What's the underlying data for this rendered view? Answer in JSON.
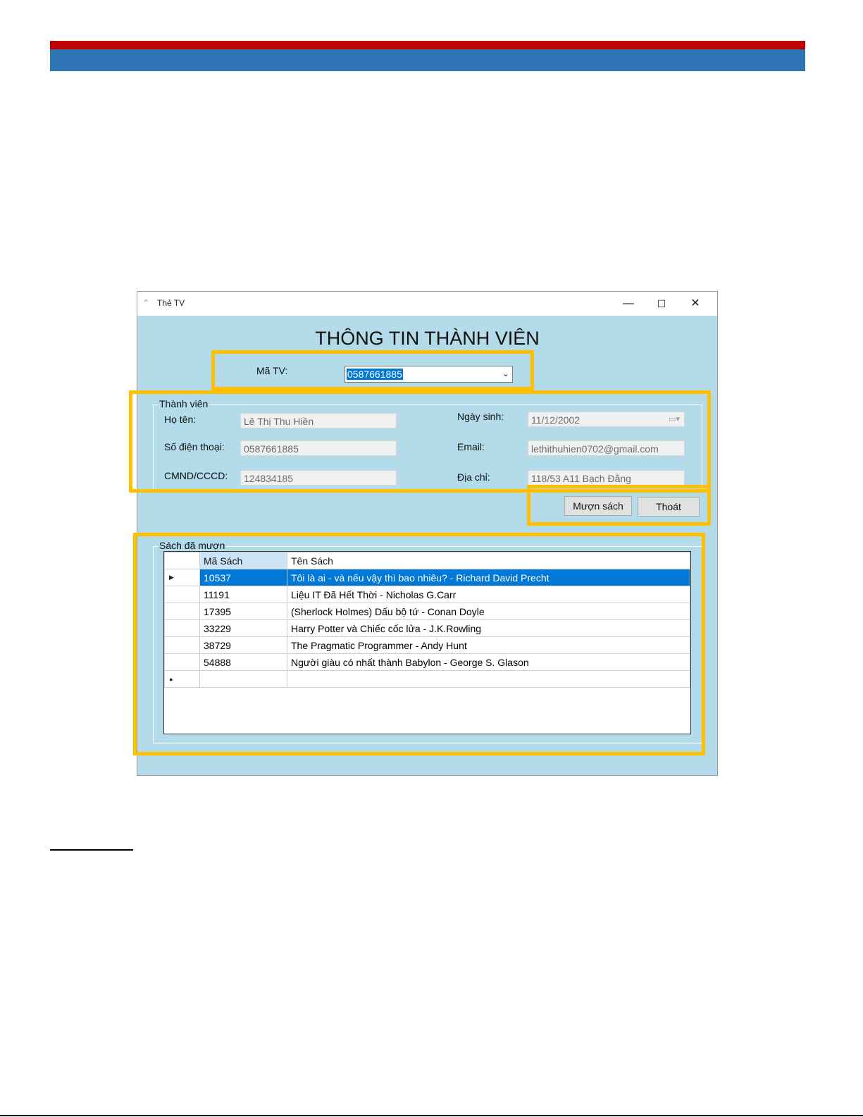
{
  "window": {
    "title": "Thẻ TV",
    "icon": "app-icon",
    "controls": {
      "minimize": "—",
      "maximize": "☐",
      "close": "✕"
    }
  },
  "form": {
    "heading": "THÔNG TIN THÀNH VIÊN",
    "member_id": {
      "label": "Mã TV:",
      "value": "0587661885"
    }
  },
  "member_group": {
    "title": "Thành viên",
    "name": {
      "label": "Họ tên:",
      "value": "Lê Thị Thu Hiền"
    },
    "phone": {
      "label": "Số điện thoại:",
      "value": "0587661885"
    },
    "id_card": {
      "label": "CMND/CCCD:",
      "value": "124834185"
    },
    "birthday": {
      "label": "Ngày sinh:",
      "value": "11/12/2002"
    },
    "email": {
      "label": "Email:",
      "value": "lethithuhien0702@gmail.com"
    },
    "address": {
      "label": "Địa chỉ:",
      "value": "118/53 A11 Bạch Đằng"
    }
  },
  "actions": {
    "borrow": "Mượn sách",
    "exit": "Thoát"
  },
  "borrowed": {
    "title": "Sách đã mượn",
    "columns": [
      "Mã Sách",
      "Tên Sách"
    ],
    "rows": [
      [
        "10537",
        "Tôi là ai - và nếu vậy thì bao nhiêu? - Richard David Precht"
      ],
      [
        "11191",
        "Liệu IT Đã Hết Thời - Nicholas G.Carr"
      ],
      [
        "17395",
        "(Sherlock Holmes) Dấu bộ tứ - Conan Doyle"
      ],
      [
        "33229",
        "Harry Potter và Chiếc cốc lửa - J.K.Rowling"
      ],
      [
        "38729",
        "The Pragmatic Programmer - Andy Hunt"
      ],
      [
        "54888",
        "Người giàu có nhất thành Babylon - George S. Glason"
      ]
    ],
    "selected_row": 0,
    "current_row_marker": "▶",
    "new_row_marker": "●"
  },
  "colors": {
    "window_bg": "#b3dbe9",
    "selection": "#0078d7",
    "highlight": "#ffc000",
    "header_red": "#c00000",
    "header_blue": "#2e74b5"
  }
}
